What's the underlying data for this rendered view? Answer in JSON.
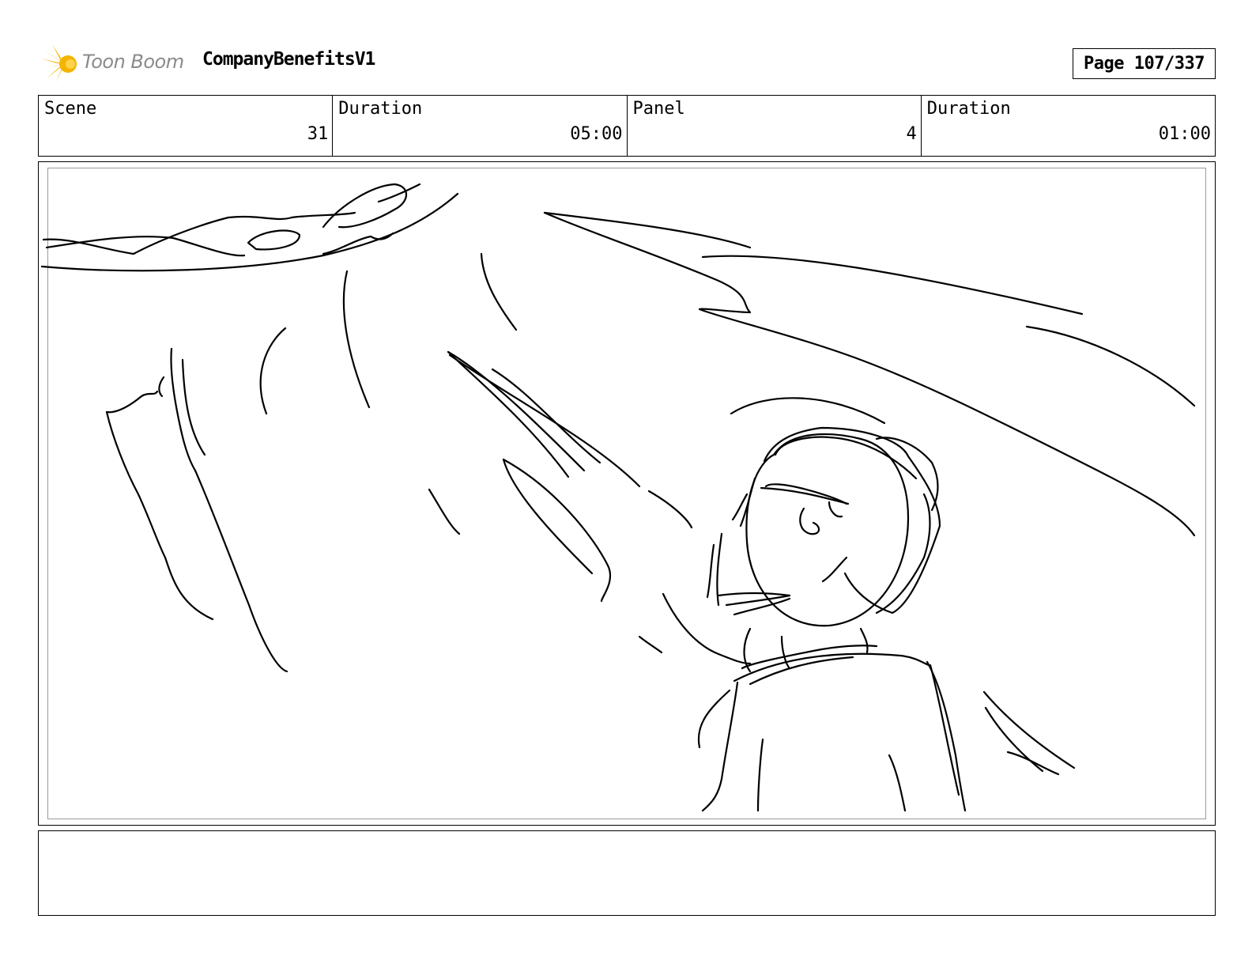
{
  "header": {
    "logo_text": "Toon Boom",
    "project_title": "CompanyBenefitsV1",
    "page_label": "Page 107/337"
  },
  "info": {
    "scene_label": "Scene",
    "scene_value": "31",
    "scene_duration_label": "Duration",
    "scene_duration_value": "05:00",
    "panel_label": "Panel",
    "panel_value": "4",
    "panel_duration_label": "Duration",
    "panel_duration_value": "01:00"
  },
  "notes": {
    "text": ""
  },
  "colors": {
    "logo_star": "#f5b400",
    "logo_text": "#8a8a8a",
    "frame_border": "#000000",
    "inner_border": "#9a9a9a"
  }
}
